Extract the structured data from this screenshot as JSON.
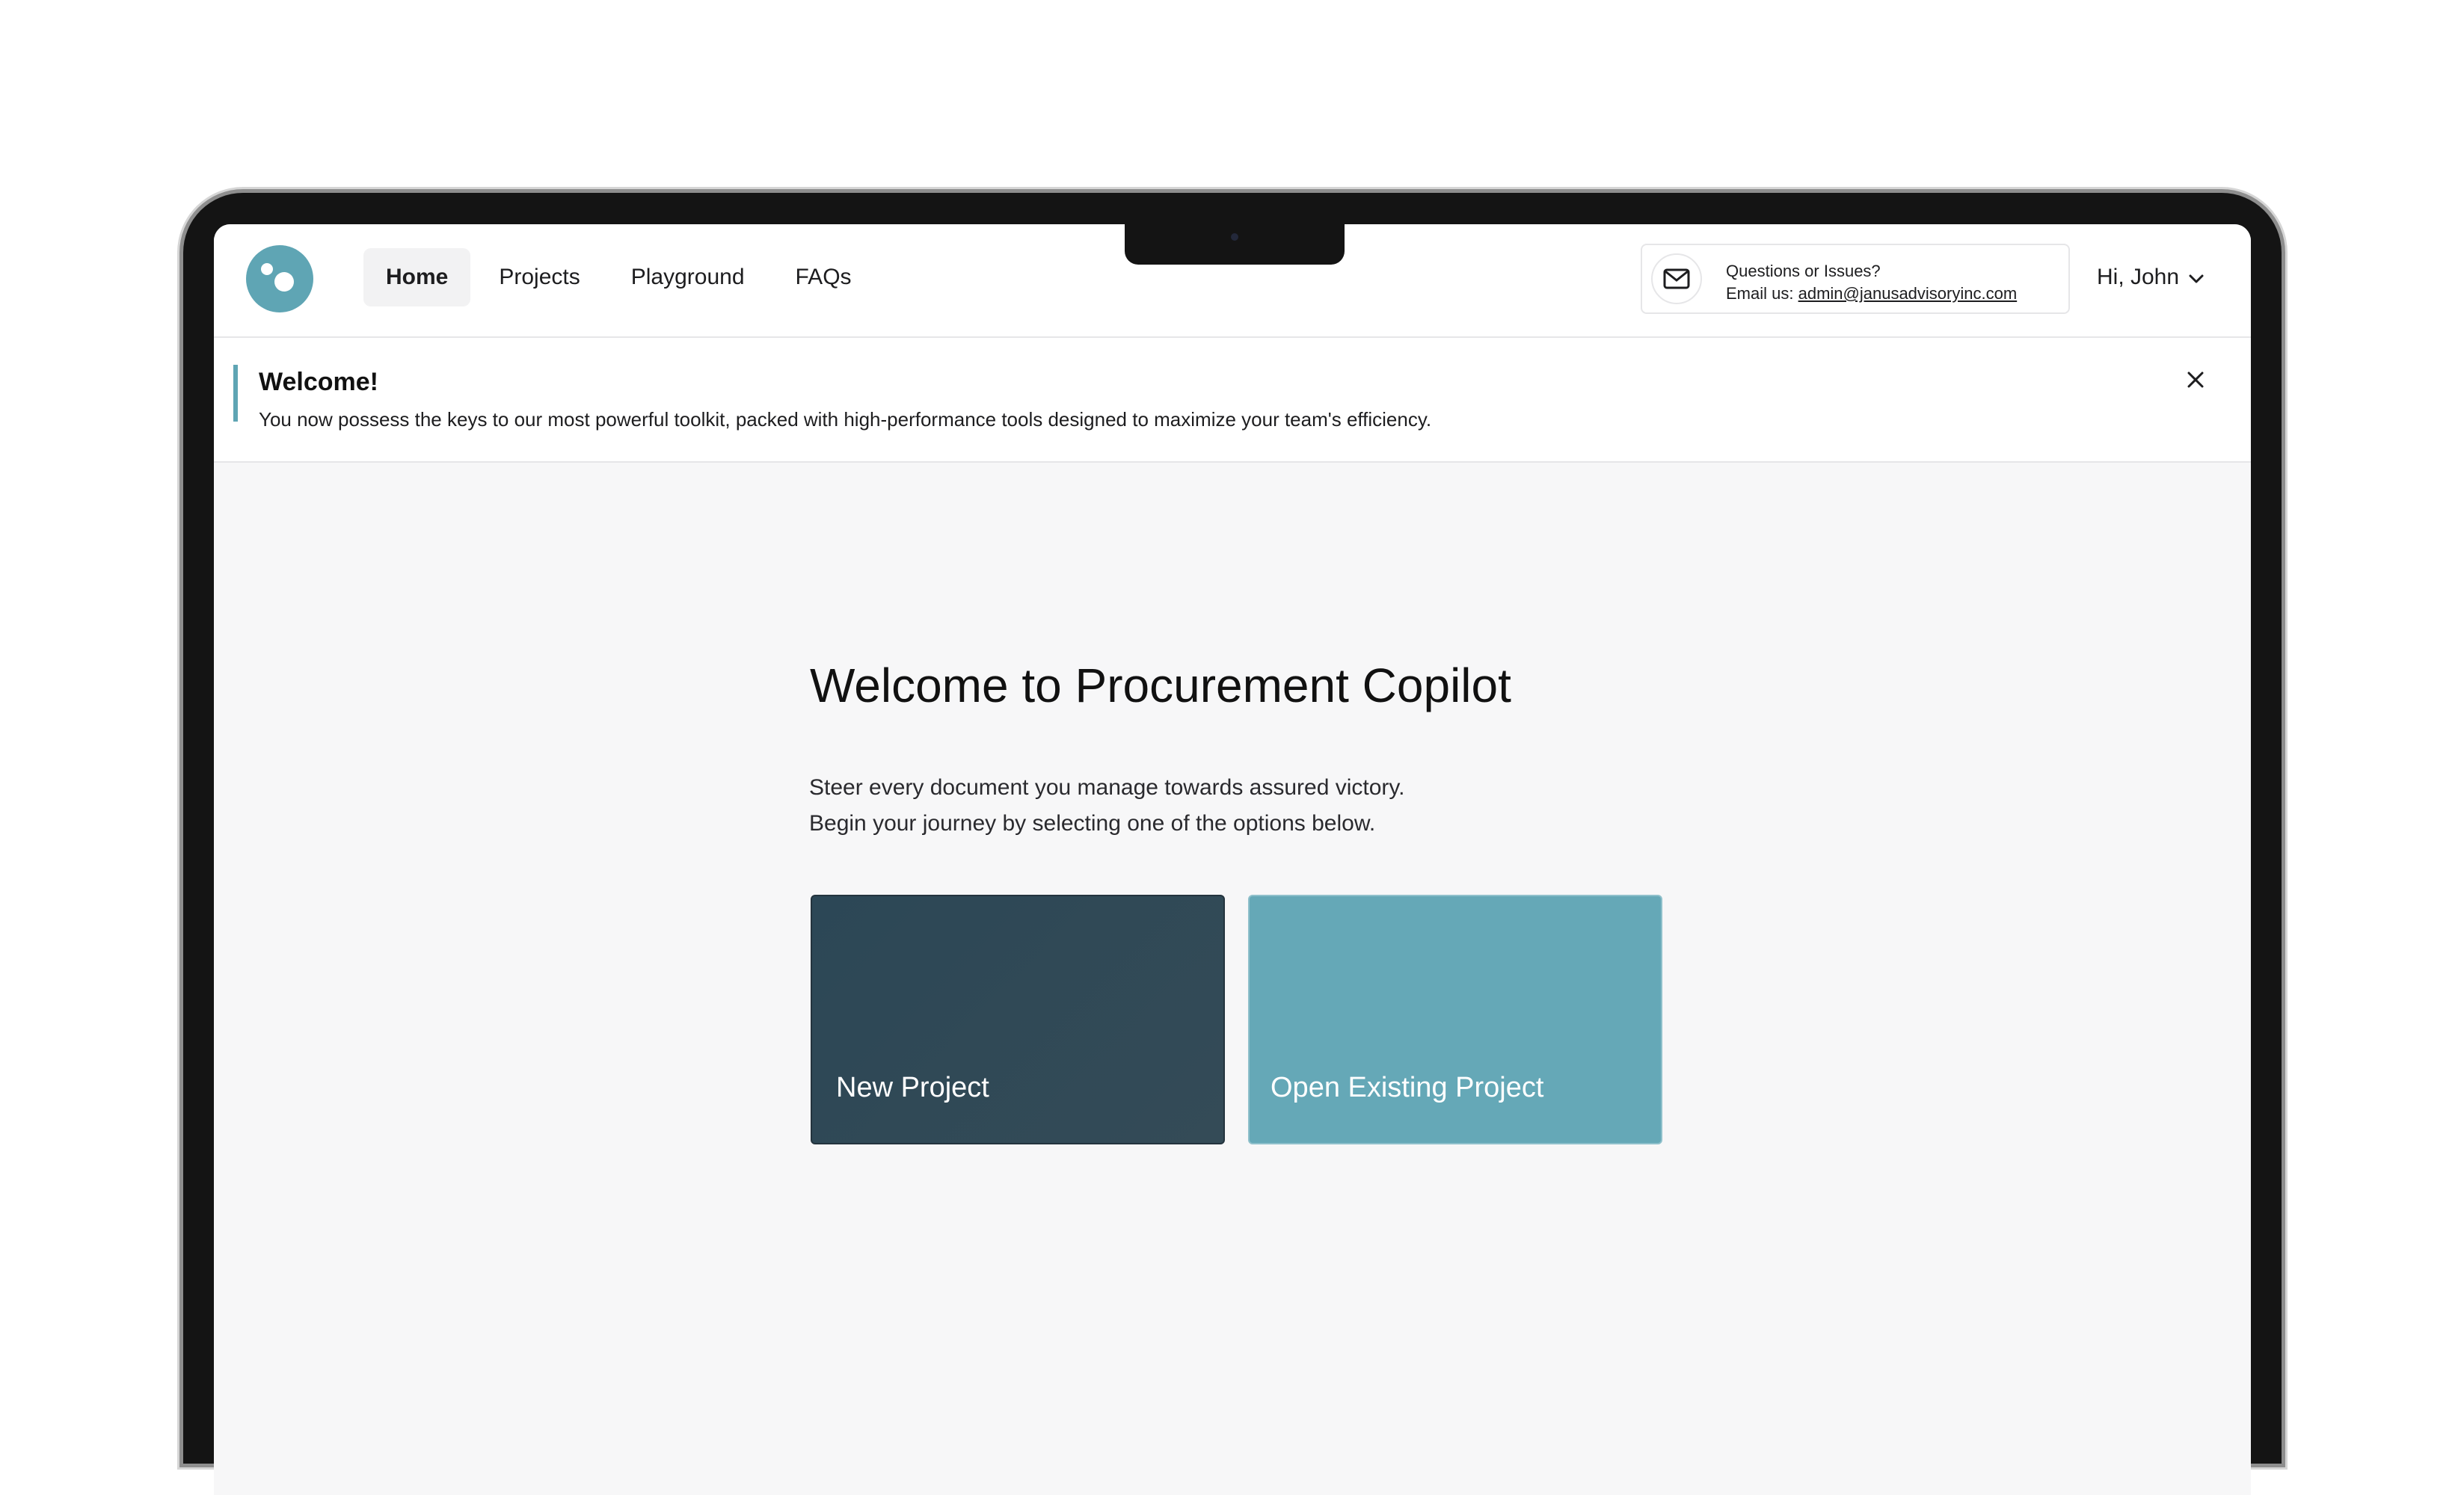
{
  "nav": {
    "items": [
      {
        "label": "Home",
        "active": true
      },
      {
        "label": "Projects",
        "active": false
      },
      {
        "label": "Playground",
        "active": false
      },
      {
        "label": "FAQs",
        "active": false
      }
    ]
  },
  "contact": {
    "title": "Questions or Issues?",
    "email_prefix": "Email us: ",
    "email": "admin@janusadvisoryinc.com",
    "icon": "mail-icon"
  },
  "user": {
    "greeting": "Hi, John",
    "icon": "chevron-down-icon"
  },
  "banner": {
    "title": "Welcome!",
    "message": "You now possess the keys to our most powerful toolkit, packed with high-performance tools designed to maximize your team's efficiency.",
    "close_icon": "close-icon"
  },
  "main": {
    "title": "Welcome to Procurement Copilot",
    "subtitle_line1": "Steer every document you manage towards assured victory.",
    "subtitle_line2": "Begin your journey by selecting one of the options below.",
    "cards": [
      {
        "label": "New Project",
        "color": "#2e4855"
      },
      {
        "label": "Open Existing Project",
        "color": "#65a8b7"
      }
    ]
  },
  "colors": {
    "accent": "#5fa5b4",
    "background": "#f7f7f8"
  }
}
